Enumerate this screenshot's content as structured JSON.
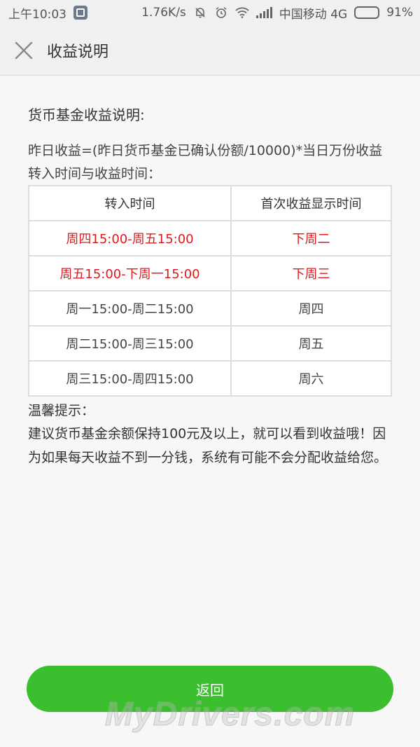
{
  "status_bar": {
    "time": "上午10:03",
    "net_speed": "1.76K/s",
    "carrier": "中国移动 4G",
    "battery": "91%",
    "battery_level": 0.91
  },
  "header": {
    "close_icon": "close-icon",
    "title": "收益说明"
  },
  "content": {
    "section_title": "货币基金收益说明:",
    "formula": "昨日收益=(昨日货币基金已确认份额/10000)*当日万份收益",
    "times_intro": "转入时间与收益时间：",
    "table": {
      "headers": [
        "转入时间",
        "首次收益显示时间"
      ],
      "rows": [
        [
          "周四15:00-周五15:00",
          "下周二"
        ],
        [
          "周五15:00-下周一15:00",
          "下周三"
        ],
        [
          "周一15:00-周二15:00",
          "周四"
        ],
        [
          "周二15:00-周三15:00",
          "周五"
        ],
        [
          "周三15:00-周四15:00",
          "周六"
        ]
      ],
      "highlight_color": "#e0191e"
    },
    "tips_title": "温馨提示：",
    "tip_text": "建议货币基金余额保持100元及以上，就可以看到收益哦！因为如果每天收益不到一分钱，系统有可能不会分配收益给您。"
  },
  "footer": {
    "back_label": "返回",
    "button_color": "#3cbf2f"
  },
  "watermark": "MyDrivers.com"
}
